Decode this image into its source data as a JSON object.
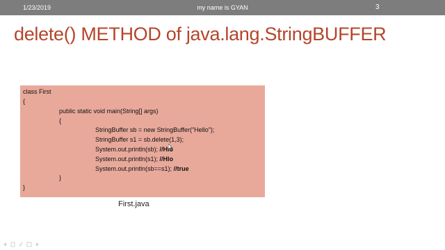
{
  "header": {
    "date": "1/23/2019",
    "center_text": "my name is GYAN",
    "page_number": "3"
  },
  "slide": {
    "title": "delete() METHOD of java.lang.StringBUFFER",
    "caption": "First.java"
  },
  "code": {
    "line1": "class First",
    "line2": "{",
    "line3": "public static void main(String[] args)",
    "line4": "{",
    "line5": "StringBuffer sb = new StringBuffer(\"Hello\");",
    "line6": "StringBuffer s1 = sb.delete(1,3);",
    "line7_code": "System.out.println(sb);",
    "line7_comment": "//Hlo",
    "line8_code": "System.out.println(s1);",
    "line8_comment": "//Hlo",
    "line9_code": "System.out.println(sb==s1);",
    "line9_comment": "//true",
    "line10": "}",
    "line11": "}"
  },
  "colors": {
    "header_bg": "#7d7d7d",
    "title": "#b5452a",
    "code_bg": "#e8a99b"
  },
  "icons": {
    "bottom_toolbar": "slide-navigation-icons",
    "cursor": "mouse-cursor-icon"
  }
}
